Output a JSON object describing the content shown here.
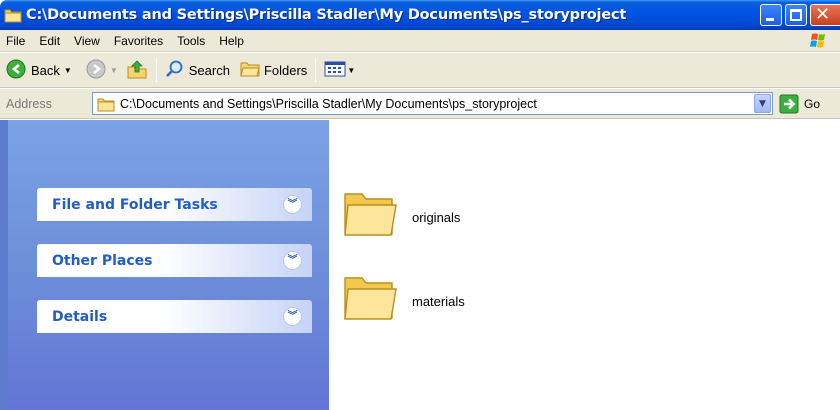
{
  "window": {
    "title": "C:\\Documents and Settings\\Priscilla Stadler\\My Documents\\ps_storyproject"
  },
  "menubar": {
    "items": [
      "File",
      "Edit",
      "View",
      "Favorites",
      "Tools",
      "Help"
    ]
  },
  "toolbar": {
    "back_label": "Back",
    "search_label": "Search",
    "folders_label": "Folders"
  },
  "address": {
    "label": "Address",
    "value": "C:\\Documents and Settings\\Priscilla Stadler\\My Documents\\ps_storyproject",
    "go_label": "Go"
  },
  "taskpane": {
    "panels": [
      {
        "title": "File and Folder Tasks"
      },
      {
        "title": "Other Places"
      },
      {
        "title": "Details"
      }
    ]
  },
  "content": {
    "items": [
      {
        "name": "originals",
        "type": "folder"
      },
      {
        "name": "materials",
        "type": "folder"
      }
    ]
  },
  "colors": {
    "titlebar": "#0055e5",
    "menubar": "#ece9d8",
    "taskpane": "#6d8fd9",
    "panel_title": "#215dc6"
  }
}
